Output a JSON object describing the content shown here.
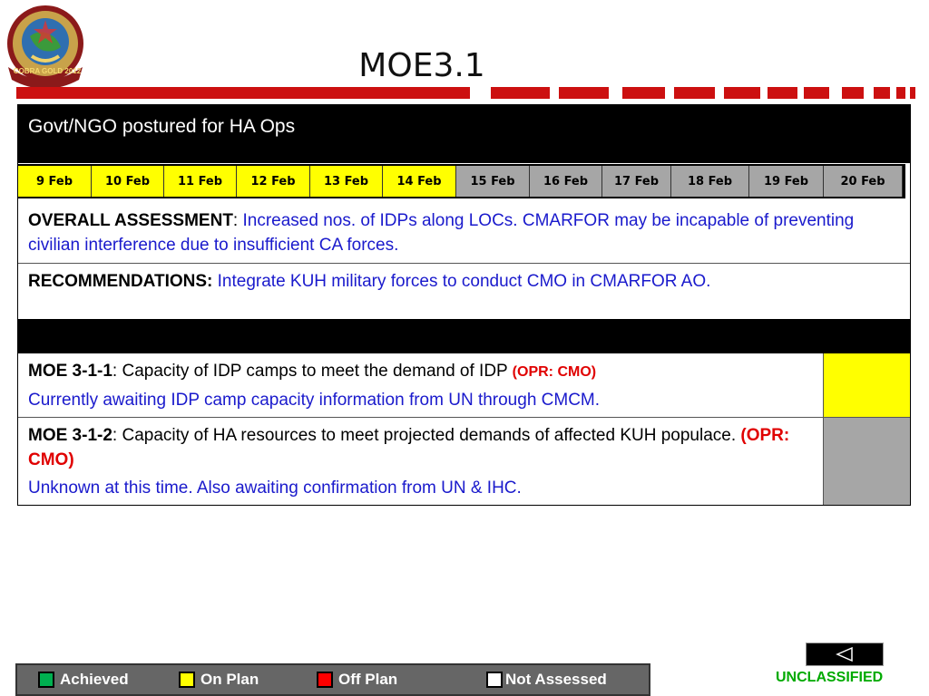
{
  "title": "MOE3.1",
  "logo": {
    "text": "COBRA GOLD 2012"
  },
  "section": {
    "title": "Govt/NGO postured for HA Ops"
  },
  "dates": [
    {
      "label": "9 Feb",
      "status": "on-plan"
    },
    {
      "label": "10 Feb",
      "status": "on-plan"
    },
    {
      "label": "11 Feb",
      "status": "on-plan"
    },
    {
      "label": "12 Feb",
      "status": "on-plan"
    },
    {
      "label": "13 Feb",
      "status": "on-plan"
    },
    {
      "label": "14 Feb",
      "status": "on-plan"
    },
    {
      "label": "15 Feb",
      "status": "not-assessed"
    },
    {
      "label": "16 Feb",
      "status": "not-assessed"
    },
    {
      "label": "17 Feb",
      "status": "not-assessed"
    },
    {
      "label": "18 Feb",
      "status": "not-assessed"
    },
    {
      "label": "19 Feb",
      "status": "not-assessed"
    },
    {
      "label": "20 Feb",
      "status": "not-assessed"
    }
  ],
  "assessment": {
    "label": "OVERALL ASSESSMENT",
    "sep": ":",
    "text": " Increased nos. of IDPs along LOCs.   CMARFOR may be incapable of preventing civilian interference due to insufficient CA forces."
  },
  "recommendations": {
    "label": "RECOMMENDATIONS:",
    "text": " Integrate KUH military forces to conduct CMO in CMARFOR AO."
  },
  "moes": [
    {
      "id": "MOE 3-1-1",
      "desc": ": Capacity of IDP camps to meet the demand of IDP ",
      "opr": "(OPR: CMO)",
      "note": "Currently awaiting IDP camp capacity information from UN through CMCM.",
      "status": "on-plan"
    },
    {
      "id": "MOE 3-1-2",
      "desc": ": Capacity of HA resources to meet projected demands of affected KUH populace. ",
      "opr": "(OPR: CMO)",
      "note": "Unknown at this time. Also awaiting confirmation from UN & IHC.",
      "status": "not-assessed"
    }
  ],
  "legend": [
    {
      "label": "Achieved",
      "color": "#00b050"
    },
    {
      "label": "On Plan",
      "color": "#ffff00"
    },
    {
      "label": "Off Plan",
      "color": "#ff0000"
    },
    {
      "label": "Not Assessed",
      "color": "#ffffff"
    }
  ],
  "colors": {
    "on_plan": "#ffff00",
    "not_assessed": "#a6a6a6",
    "label_blue": "#1a1acc",
    "opr_red": "#e00000",
    "unclassified_green": "#00aa00"
  },
  "classification": "UNCLASSIFIED"
}
